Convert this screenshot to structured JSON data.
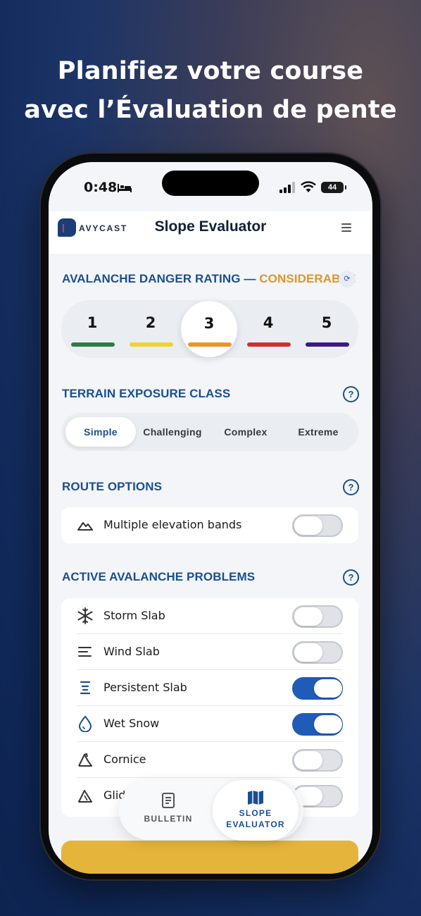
{
  "headline": {
    "line1": "Planifiez votre course",
    "line2": "avec l’Évaluation de pente"
  },
  "status": {
    "time": "0:48",
    "battery": "44"
  },
  "app": {
    "logo_text": "AVYCAST",
    "title": "Slope Evaluator"
  },
  "danger": {
    "label": "AVALANCHE DANGER RATING",
    "separator": " — ",
    "value": "CONSIDERABLE",
    "selected": "3",
    "ratings": [
      {
        "num": "1",
        "color": "#2f7a47"
      },
      {
        "num": "2",
        "color": "#ecd23a"
      },
      {
        "num": "3",
        "color": "#e8952e"
      },
      {
        "num": "4",
        "color": "#c83232"
      },
      {
        "num": "5",
        "color": "#3a1a7a"
      }
    ]
  },
  "terrain": {
    "title": "TERRAIN EXPOSURE CLASS",
    "help": "?",
    "selected": "Simple",
    "options": [
      "Simple",
      "Challenging",
      "Complex",
      "Extreme"
    ]
  },
  "route": {
    "title": "ROUTE OPTIONS",
    "help": "?",
    "items": [
      {
        "label": "Multiple elevation bands",
        "icon": "mountain-icon",
        "on": false
      }
    ]
  },
  "problems": {
    "title": "ACTIVE AVALANCHE PROBLEMS",
    "help": "?",
    "items": [
      {
        "label": "Storm Slab",
        "icon": "snowflake-icon",
        "on": false
      },
      {
        "label": "Wind Slab",
        "icon": "wind-icon",
        "on": false
      },
      {
        "label": "Persistent Slab",
        "icon": "layers-icon",
        "on": true
      },
      {
        "label": "Wet Snow",
        "icon": "droplet-icon",
        "on": true
      },
      {
        "label": "Cornice",
        "icon": "cornice-icon",
        "on": false
      },
      {
        "label": "Glid",
        "icon": "glide-icon",
        "on": false
      }
    ]
  },
  "tabs": {
    "bulletin": "BULLETIN",
    "slope_line1": "SLOPE",
    "slope_line2": "EVALUATOR"
  },
  "colors": {
    "accent": "#1b4f8f",
    "toggle_on": "#1f5cb8",
    "danger_word": "#e4932b",
    "cta": "#e4b53a"
  }
}
